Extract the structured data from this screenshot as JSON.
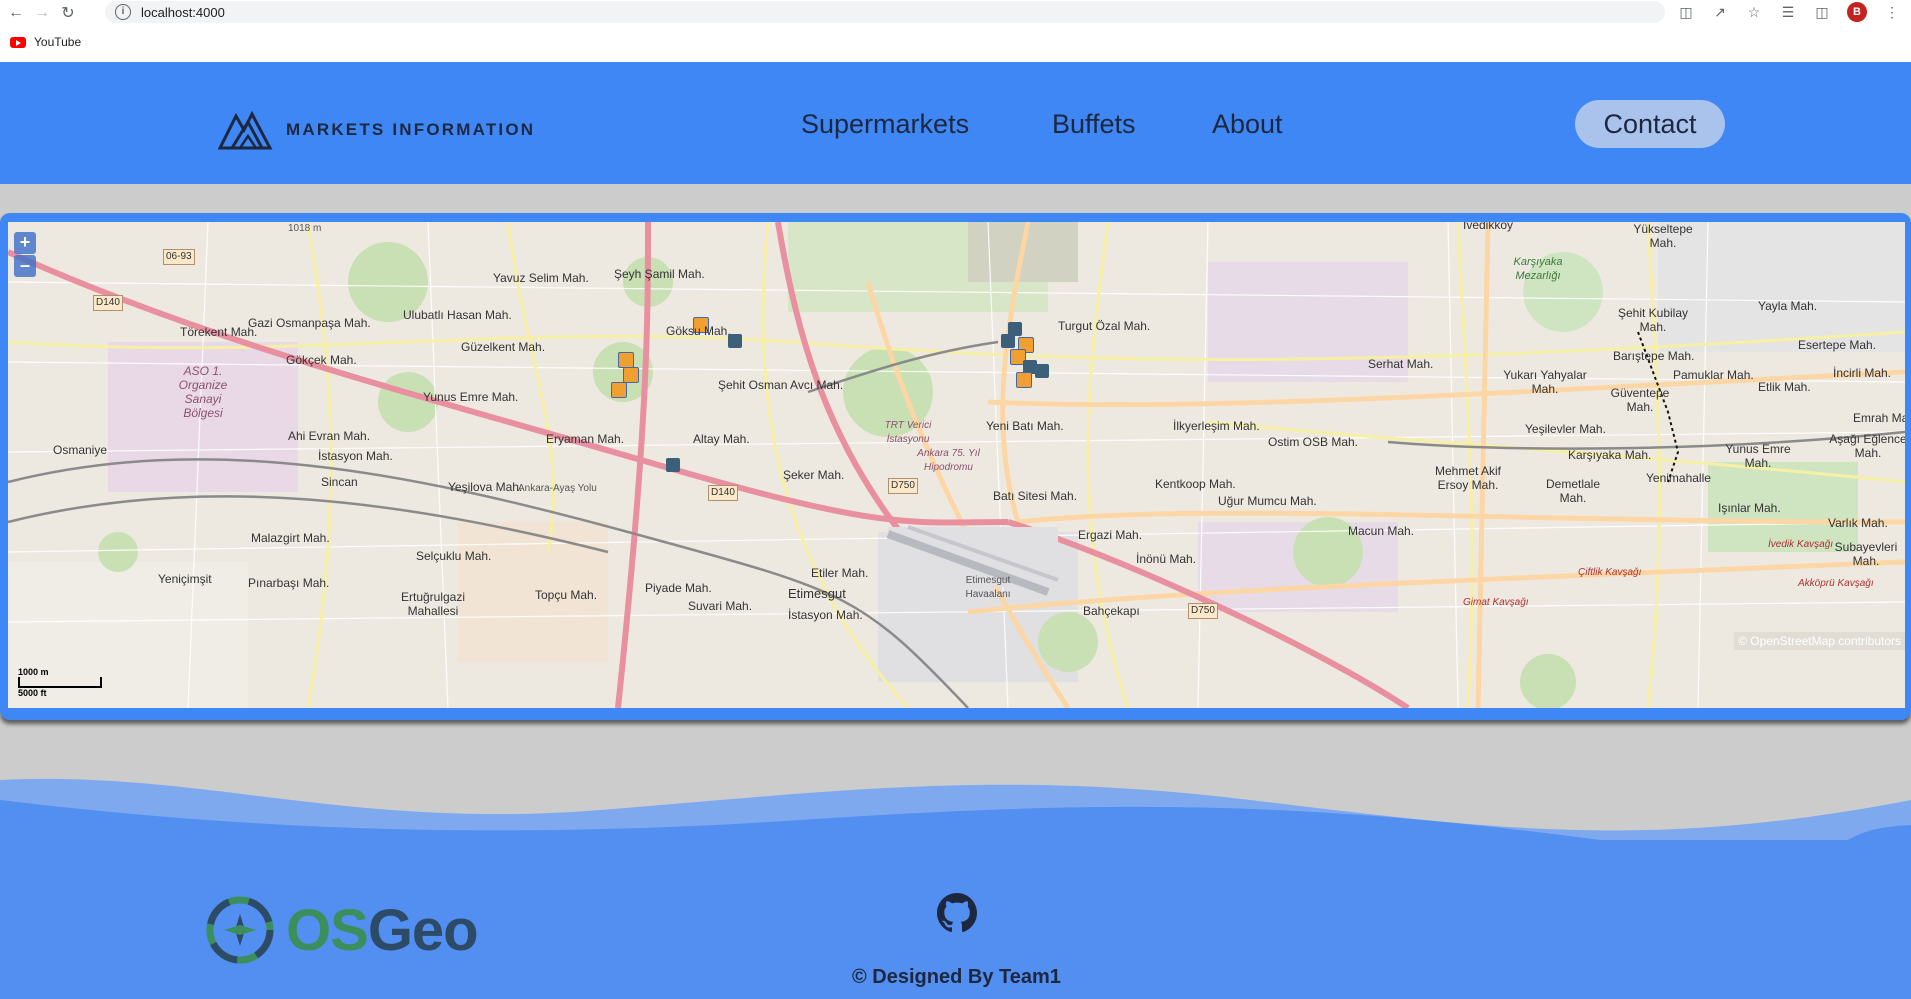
{
  "browser": {
    "url": "localhost:4000",
    "bookmark_label": "YouTube",
    "profile_initial": "B"
  },
  "header": {
    "logo_text": "MARKETS INFORMATION",
    "nav": [
      "Supermarkets",
      "Buffets",
      "About"
    ],
    "contact_label": "Contact"
  },
  "map": {
    "zoom_in": "+",
    "zoom_out": "–",
    "scale_m": "1000 m",
    "scale_ft": "5000 ft",
    "attribution": "© OpenStreetMap contributors",
    "labels": {
      "gazi": "Gazi Osmanpaşa Mah.",
      "torekent": "Törekent Mah.",
      "ulubatli": "Ulubatlı Hasan Mah.",
      "yavuz": "Yavuz Selim Mah.",
      "seyh": "Şeyh Şamil Mah.",
      "goksu": "Göksu Mah.",
      "gokcek": "Gökçek Mah.",
      "guzelkent": "Güzelkent Mah.",
      "aso": "ASO 1. Organize Sanayi Bölgesi",
      "yunusemre1": "Yunus Emre Mah.",
      "sehitosman": "Şehit Osman Avcı Mah.",
      "ahievran": "Ahi Evran Mah.",
      "istasyon": "İstasyon Mah.",
      "eryaman": "Eryaman Mah.",
      "altay": "Altay Mah.",
      "osmaniye": "Osmaniye",
      "sincan": "Sincan",
      "yesilova": "Yeşilova Mah.",
      "seker": "Şeker Mah.",
      "malazgirt": "Malazgirt Mah.",
      "selcuklu": "Selçuklu Mah.",
      "yenicimsit": "Yeniçimşit",
      "pinarbasi": "Pınarbaşı Mah.",
      "ertugrulgazi": "Ertuğrulgazi Mahallesi",
      "topcu": "Topçu Mah.",
      "piyade": "Piyade Mah.",
      "suvari": "Suvari Mah.",
      "etiler": "Etiler Mah.",
      "etimesgut": "Etimesgut",
      "istasyon2": "İstasyon Mah.",
      "etimesgutair": "Etimesgut Havaalanı",
      "trt": "TRT Verici İstasyonu",
      "hipodrom": "Ankara 75. Yıl Hipodromu",
      "turgutozal": "Turgut Özal Mah.",
      "yenibati": "Yeni Batı Mah.",
      "batisitesi": "Batı Sitesi Mah.",
      "ergazi": "Ergazi Mah.",
      "bahcekapi": "Bahçekapı",
      "inonu": "İnönü Mah.",
      "kentkoop": "Kentkoop Mah.",
      "ugurmumcu": "Uğur Mumcu Mah.",
      "ilkyerlesim": "İlkyerleşim Mah.",
      "ostimosb": "Ostim OSB Mah.",
      "serhat": "Serhat Mah.",
      "macun": "Macun Mah.",
      "mehmetakif": "Mehmet Akif Ersoy Mah.",
      "yukariyahyalar": "Yukarı Yahyalar Mah.",
      "yesilevler": "Yeşilevler Mah.",
      "karsiyaka": "Karşıyaka Mah.",
      "demetlale": "Demetlale Mah.",
      "yenimahalle": "Yenimahalle",
      "yunusemre2": "Yunus Emre Mah.",
      "isinlar": "Işınlar Mah.",
      "varlik": "Varlık Mah.",
      "yayla": "Yayla Mah.",
      "yukseltepe": "Yükseltepe Mah.",
      "sehitkubilay": "Şehit Kubilay Mah.",
      "baristepe": "Barıştepe Mah.",
      "pamuklar": "Pamuklar Mah.",
      "guventepe": "Güventepe Mah.",
      "esertepe": "Esertepe Mah.",
      "incirli": "İncirli Mah.",
      "etlik": "Etlik Mah.",
      "emrah": "Emrah Mah.",
      "asagieglence": "Aşağı Eğlence Mah.",
      "karsiyakamezar": "Karşıyaka Mezarlığı",
      "subayevleri": "Subayevleri Mah.",
      "ivedikkoy": "İvedikköy",
      "d140": "D140",
      "d750": "D750",
      "d140b": "D140",
      "d750b": "D750",
      "r0693": "06-93",
      "ankarayolu": "Ankara-Ayaş Yolu",
      "ivedik": "İvedik Kavşağı",
      "cifcik": "Çiftlik Kavşağı",
      "gimat": "Gimat Kavşağı",
      "akkopru": "Akköprü Kavşağı",
      "alt1018": "1018 m"
    }
  },
  "footer": {
    "osgeo_text_a": "OS",
    "osgeo_text_b": "Geo",
    "copyright": "© Designed By Team1"
  }
}
